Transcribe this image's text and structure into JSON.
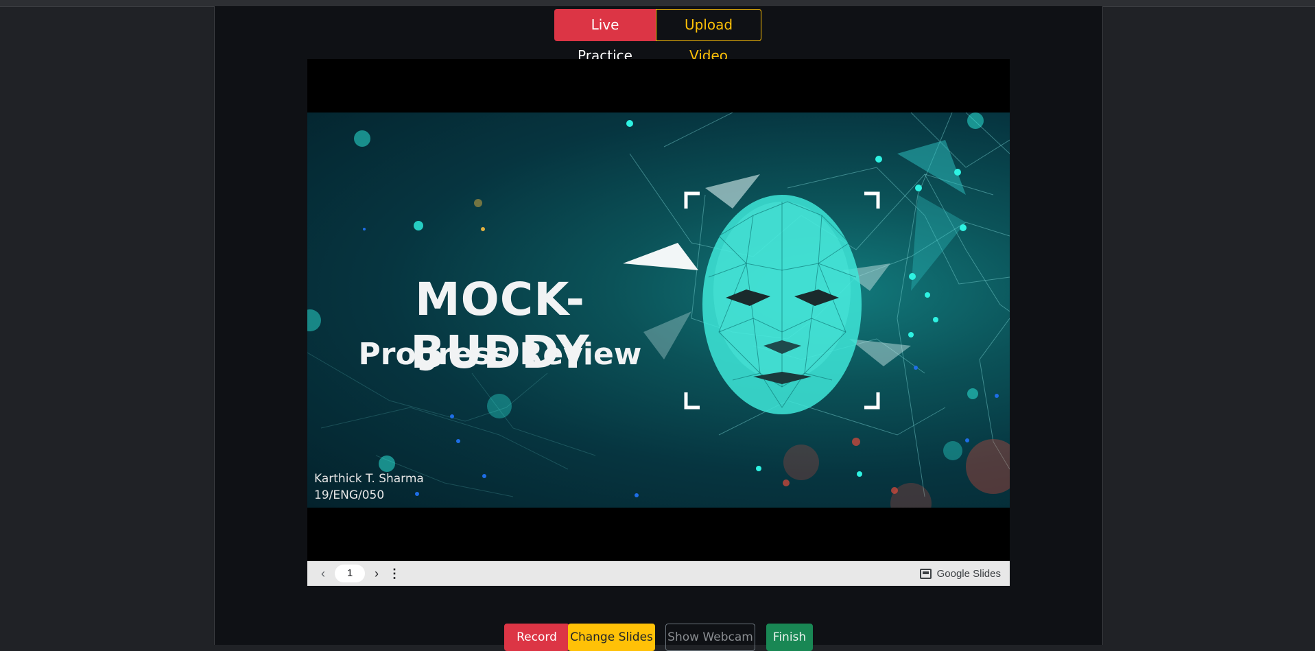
{
  "mode_toggle": {
    "live_label": "Live Practice",
    "upload_label": "Upload Video"
  },
  "slide": {
    "title": "MOCK-BUDDY",
    "subtitle": "Progress Review",
    "author_name": "Karthick T. Sharma",
    "author_id": "19/ENG/050"
  },
  "slides_bar": {
    "page": "1",
    "brand": "Google Slides"
  },
  "actions": {
    "record": "Record",
    "change_slides": "Change Slides",
    "show_webcam": "Show Webcam",
    "finish": "Finish"
  },
  "colors": {
    "danger": "#dc3545",
    "warning": "#ffc107",
    "success": "#198754",
    "panel_bg": "#0f1115"
  }
}
